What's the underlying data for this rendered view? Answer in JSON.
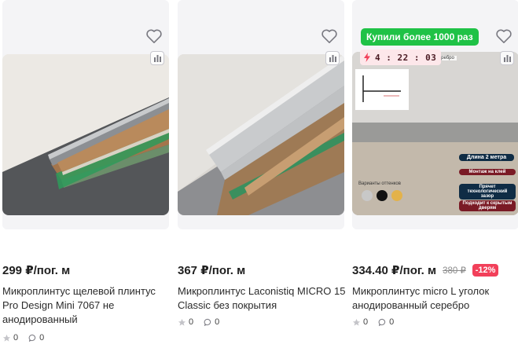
{
  "products": [
    {
      "price": "299 ₽/пог. м",
      "title": "Микроплинтус щелевой плинтус Pro Design Mini 7067 не анодированный",
      "rating": "0",
      "comments": "0"
    },
    {
      "price": "367 ₽/пог. м",
      "title": "Микроплинтус Laconistiq MICRO 15 Classic без покрытия",
      "rating": "0",
      "comments": "0"
    },
    {
      "promo_badge": "Купили более 1000 раз",
      "timer": "4 : 22 : 03",
      "price": "334.40 ₽/пог. м",
      "old_price": "380 ₽",
      "discount": "-12%",
      "title": "Микроплинтус micro L уголок анодированный серебро",
      "rating": "0",
      "comments": "0",
      "image_text": {
        "top_caption": "анодированный серебро",
        "length": "Длина 2 метра",
        "mount": "Монтаж на клей",
        "gap": "Прячет технологический зазор",
        "doors": "Подходит к скрытым дверям",
        "colors_label": "Варианты оттенков"
      }
    }
  ],
  "colors": {
    "accent_green": "#1fc246",
    "discount_red": "#f2405a",
    "timer_bg": "#fde7ea"
  },
  "icons": [
    "heart-icon",
    "compare-icon",
    "lightning-icon",
    "star-icon",
    "comment-icon"
  ]
}
